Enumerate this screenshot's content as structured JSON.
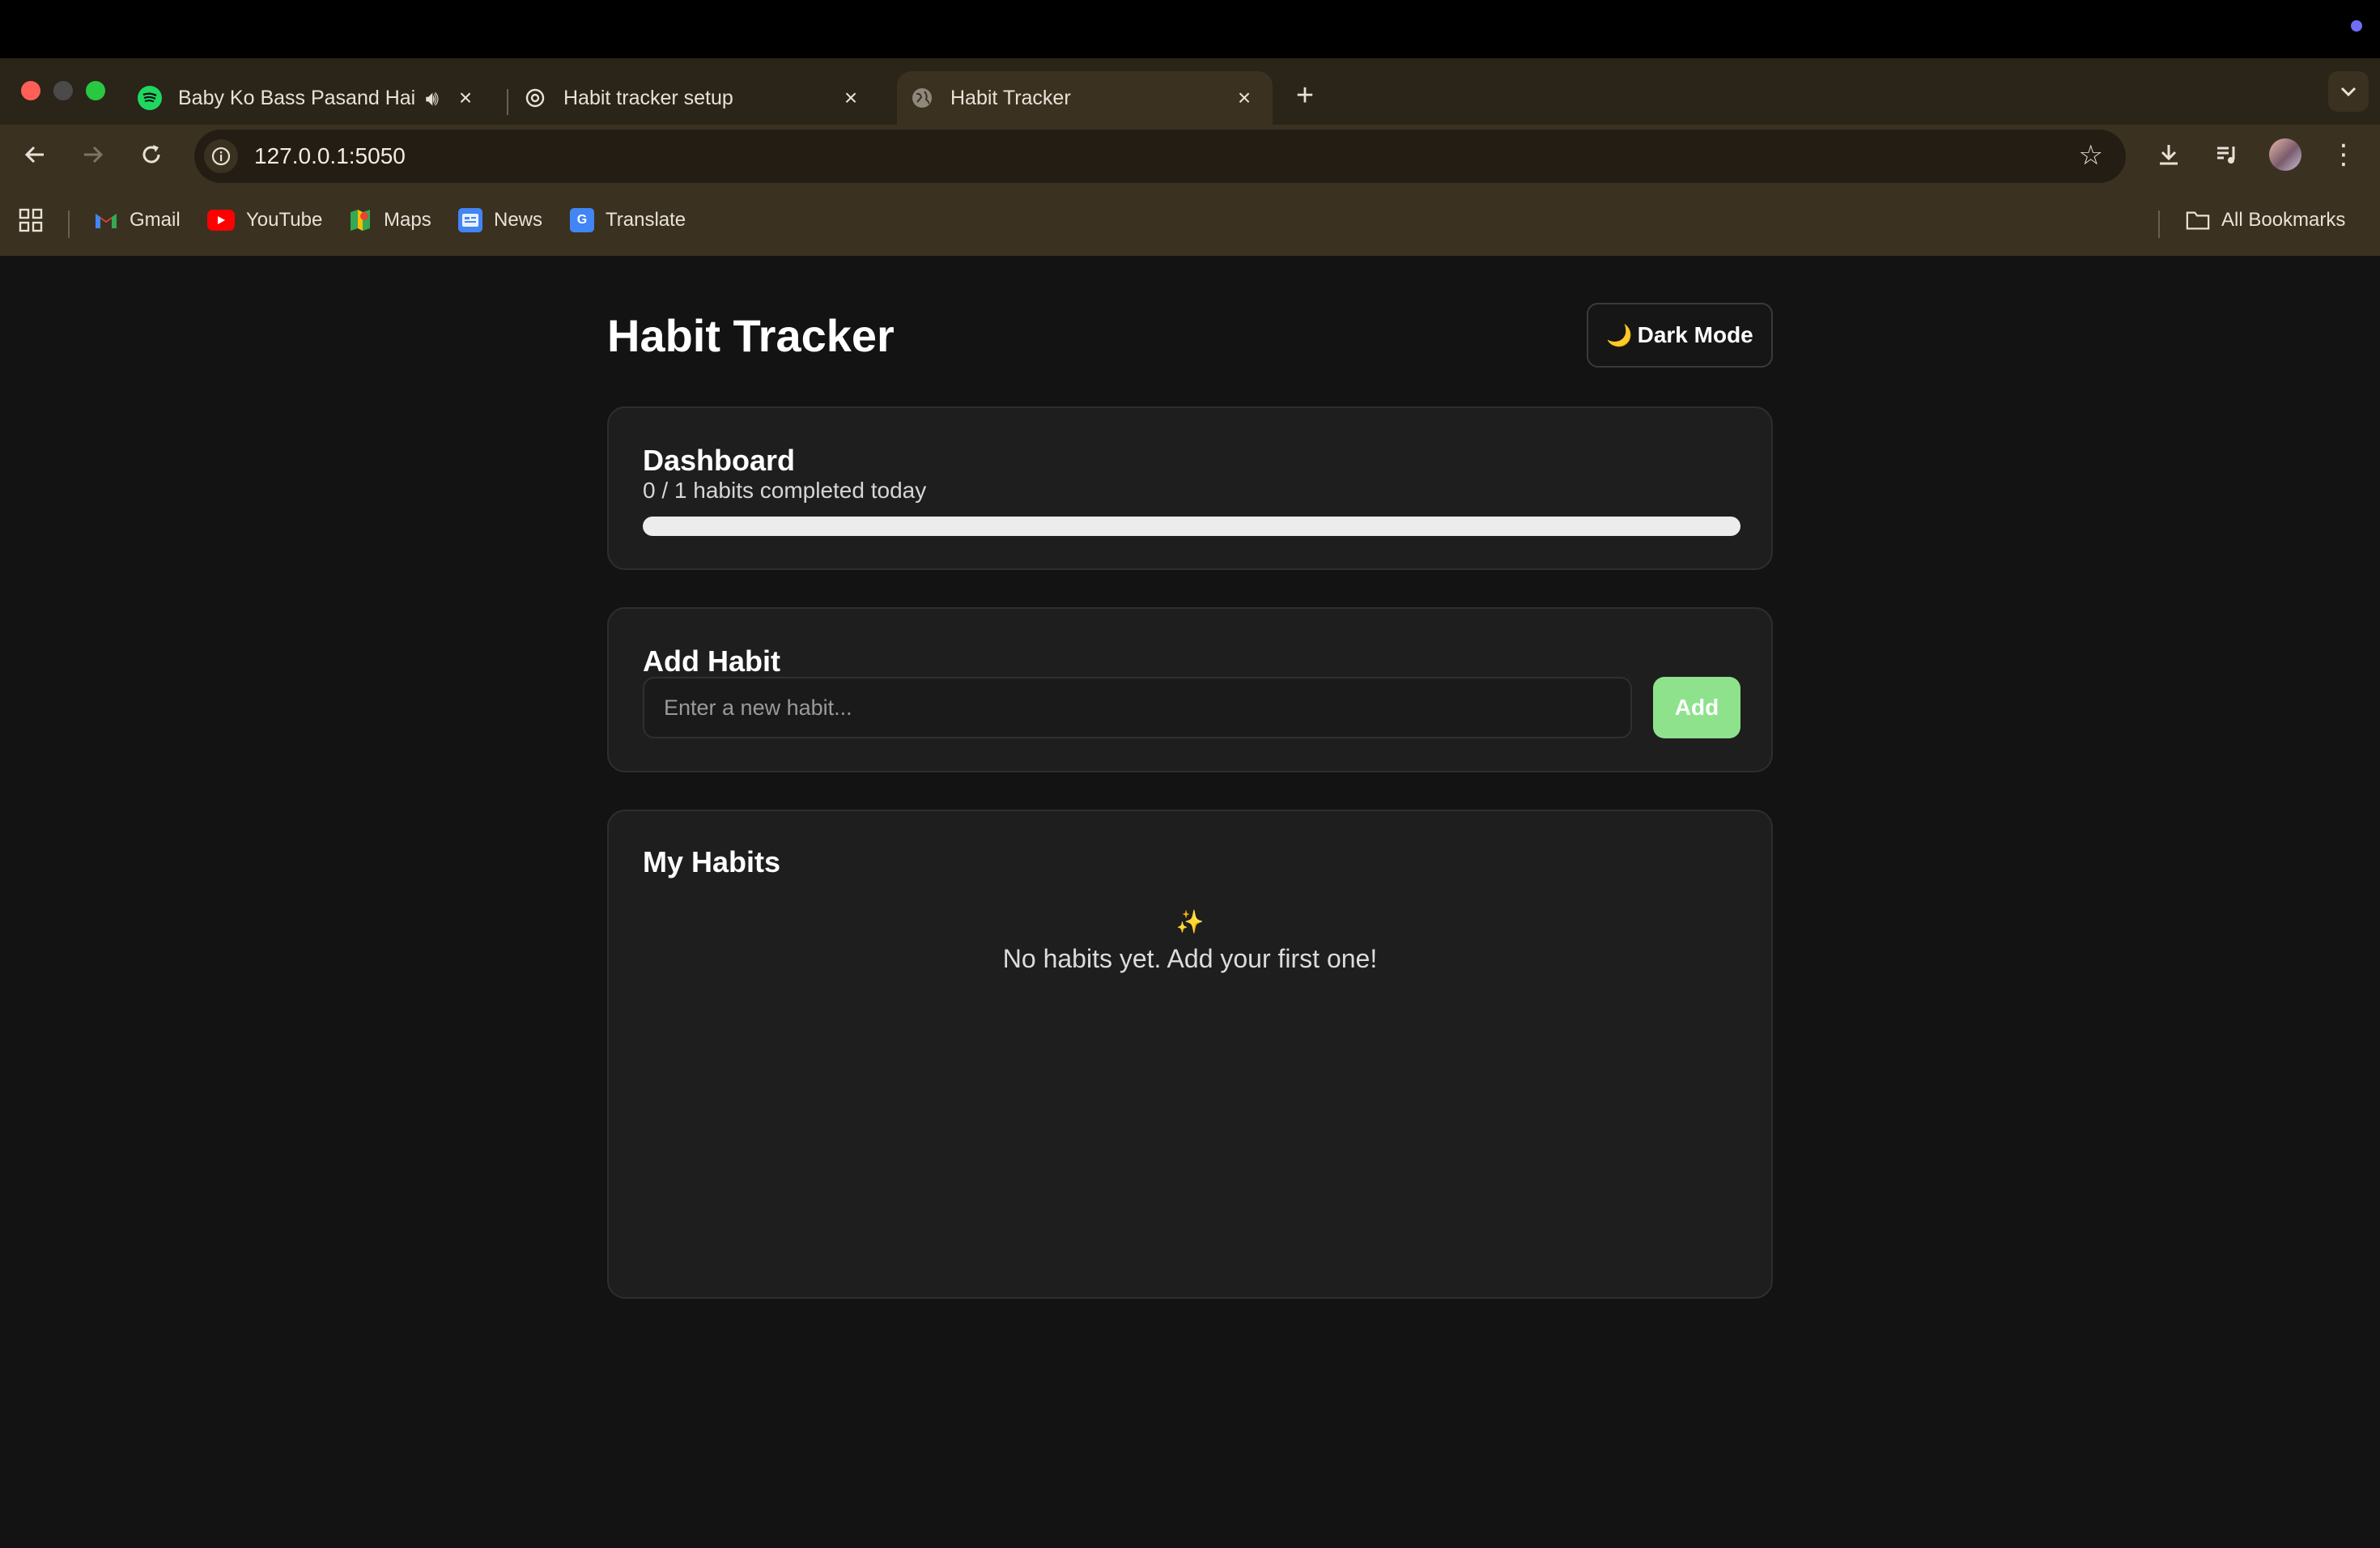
{
  "browser": {
    "tabs": [
      {
        "title": "Baby Ko Bass Pasand Hai",
        "favicon": "spotify-icon",
        "audio": true
      },
      {
        "title": "Habit tracker setup",
        "favicon": "openai-icon"
      },
      {
        "title": "Habit Tracker",
        "favicon": "globe-icon",
        "active": true
      }
    ],
    "url": "127.0.0.1:5050",
    "bookmarks": [
      {
        "label": "Gmail",
        "icon": "gmail-icon"
      },
      {
        "label": "YouTube",
        "icon": "youtube-icon"
      },
      {
        "label": "Maps",
        "icon": "maps-icon"
      },
      {
        "label": "News",
        "icon": "news-icon"
      },
      {
        "label": "Translate",
        "icon": "translate-icon"
      }
    ],
    "all_bookmarks_label": "All Bookmarks"
  },
  "app": {
    "title": "Habit Tracker",
    "dark_mode_icon": "🌙",
    "dark_mode_label": "Dark Mode"
  },
  "dashboard": {
    "title": "Dashboard",
    "summary": "0 / 1 habits completed today",
    "completed": 0,
    "total": 1,
    "progress_percent": 0
  },
  "add_habit": {
    "title": "Add Habit",
    "placeholder": "Enter a new habit...",
    "value": "",
    "button_label": "Add"
  },
  "habits": {
    "title": "My Habits",
    "empty_icon": "✨",
    "empty_text": "No habits yet. Add your first one!"
  },
  "colors": {
    "page_bg": "#131313",
    "card_bg": "#1e1e1e",
    "accent_green": "#8ee28c",
    "chrome_bg": "#3b3121"
  }
}
